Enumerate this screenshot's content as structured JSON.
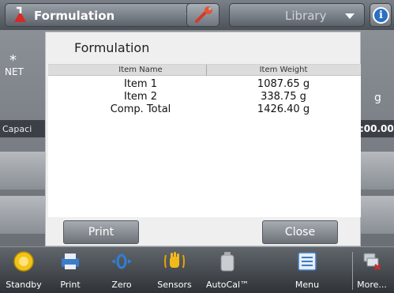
{
  "header": {
    "app_name": "Formulation",
    "library_label": "Library",
    "info_glyph": "i"
  },
  "background": {
    "stability_mark": "*",
    "net_label": "NET",
    "unit": "g",
    "capacity_label": "Capaci",
    "capacity_value": ":00.00"
  },
  "dialog": {
    "title": "Formulation",
    "columns": [
      "Item Name",
      "Item Weight"
    ],
    "rows": [
      {
        "name": "Item 1",
        "weight": "1087.65 g"
      },
      {
        "name": "Item 2",
        "weight": "338.75 g"
      },
      {
        "name": "Comp. Total",
        "weight": "1426.40 g"
      }
    ],
    "print_label": "Print",
    "close_label": "Close"
  },
  "toolbar": {
    "items": [
      {
        "label": "Standby",
        "icon": "standby-icon"
      },
      {
        "label": "Print",
        "icon": "printer-icon"
      },
      {
        "label": "Zero",
        "icon": "zero-icon"
      },
      {
        "label": "Sensors",
        "icon": "hand-sensor-icon"
      },
      {
        "label": "AutoCal™",
        "icon": "calibration-weight-icon"
      },
      {
        "label": "Menu",
        "icon": "menu-icon"
      },
      {
        "label": "More...",
        "icon": "more-icon"
      }
    ]
  },
  "colors": {
    "standby_yellow": "#f2c318",
    "print_blue": "#3b7cc9",
    "zero_blue": "#2f7fd6",
    "sensor_yellow": "#f3b81a",
    "info_blue": "#2a6fc1"
  }
}
